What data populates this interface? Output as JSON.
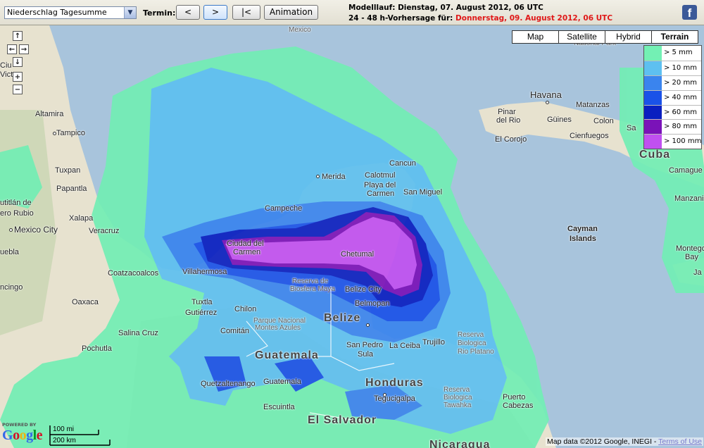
{
  "toolbar": {
    "variable_select": "Niederschlag Tagesumme",
    "termin_label": "Termin:",
    "prev_label": "<",
    "next_label": ">",
    "first_label": "|<",
    "animation_label": "Animation",
    "modelllauf": "Modelllauf: Dienstag, 07. August 2012, 06 UTC",
    "forecast_prefix": "24 - 48 h-Vorhersage für: ",
    "forecast_date": "Donnerstag, 09. August 2012, 06 UTC"
  },
  "map_types": [
    "Map",
    "Satellite",
    "Hybrid",
    "Terrain"
  ],
  "active_map_type": "Terrain",
  "legend": [
    {
      "label": "> 5 mm",
      "color": "#73f0b4"
    },
    {
      "label": "> 10 mm",
      "color": "#5ec0f0"
    },
    {
      "label": "> 20 mm",
      "color": "#3a84ee"
    },
    {
      "label": "> 40 mm",
      "color": "#1a52e8"
    },
    {
      "label": "> 60 mm",
      "color": "#0a1fc0"
    },
    {
      "label": "> 80 mm",
      "color": "#7a12b8"
    },
    {
      "label": "> 100 mm",
      "color": "#c050f0"
    }
  ],
  "nav": {
    "up": "↑",
    "left": "←",
    "right": "→",
    "down": "↓",
    "zoom_in": "+",
    "zoom_out": "−"
  },
  "places": {
    "mexico": "Mexico",
    "national_park": "National Park",
    "cuidad_victoria": "Ciu",
    "victoria": "Victo",
    "altamira": "Altamira",
    "tampico": "Tampico",
    "tuxpan": "Tuxpan",
    "papantla": "Papantla",
    "gutierrez": "utitlán de",
    "poza_rica": "ero Rubio",
    "xalapa": "Xalapa",
    "mexico_city": "Mexico City",
    "veracruz": "Veracruz",
    "puebla": "uebla",
    "coatzacoalcos": "Coatzacoalcos",
    "cingo": "ncingo",
    "oaxaca": "Oaxaca",
    "salina_cruz": "Salina Cruz",
    "pochutla": "Pochutla",
    "campeche": "Campeche",
    "merida": "Merida",
    "cancun": "Cancun",
    "calotmul": "Calotmul",
    "playa": "Playa del",
    "carmen": "Carmen",
    "san_miguel": "San Miguel",
    "ciudad_del": "Ciudad del",
    "carmen2": "Carmen",
    "chetumal": "Chetumal",
    "villahermosa": "Villahermosa",
    "tuxtla": "Tuxtla",
    "gutierrez2": "Gutiérrez",
    "chilon": "Chilon",
    "reserva": "Reserva de",
    "biosfera": "Biosfera Maya",
    "belize_city": "Belize City",
    "belmopan": "Belmopan",
    "belize": "Belize",
    "comitan": "Comitán",
    "parque": "Parque Nacional",
    "montes": "Montes Azules",
    "guatemala": "Guatemala",
    "quetzaltenango": "Quetzaltenango",
    "guatemala_city": "Guatemala",
    "escuintla": "Escuintla",
    "san_pedro": "San Pedro",
    "sula": "Sula",
    "la_ceiba": "La Ceiba",
    "trujillo": "Trujillo",
    "reserva2": "Reserva",
    "biologica": "Biologica",
    "rio_platano": "Rio Platano",
    "honduras": "Honduras",
    "tegucigalpa": "Tegucigalpa",
    "reserva3": "Reserva",
    "bosawas": "Biologica",
    "tawahka": "Tawahka",
    "puerto": "Puerto",
    "cabezas": "Cabezas",
    "el_salvador": "El Salvador",
    "nicaragua": "Nicaragua",
    "havana": "Havana",
    "matanzas": "Matanzas",
    "pinar": "Pinar",
    "del_rio": "del Rio",
    "guines": "Güines",
    "colon": "Colon",
    "santa_clara": "Sa",
    "cienfuegos": "Cienfuegos",
    "el_corojo": "El Corojo",
    "cuba": "Cuba",
    "camaguey": "Camague",
    "manzanillo": "Manzanill",
    "cayman1": "Cayman",
    "cayman2": "Islands",
    "montego1": "Montego",
    "montego2": "Bay",
    "jamaica": "Ja"
  },
  "google": {
    "powered_by": "POWERED BY",
    "logo": "Google"
  },
  "scale": {
    "mi": "100 mi",
    "km": "200 km"
  },
  "copyright": "Map data ©2012 Google, INEGI - ",
  "terms": "Terms of Use"
}
